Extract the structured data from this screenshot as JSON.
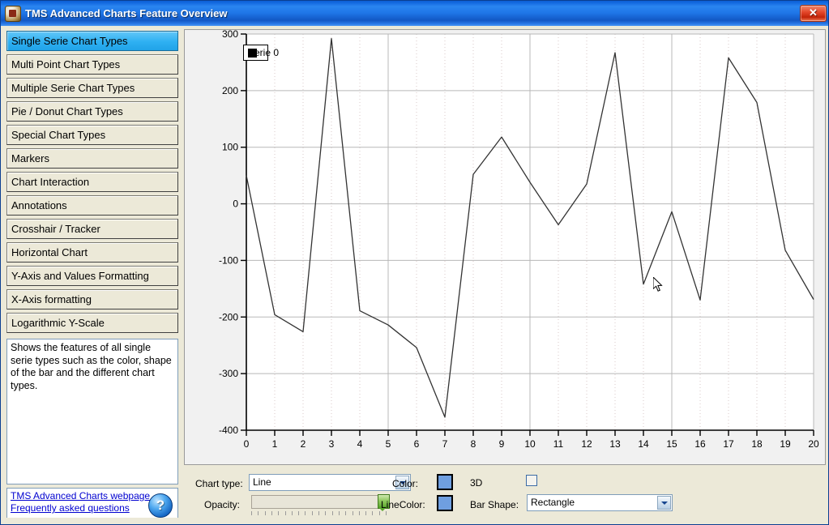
{
  "window": {
    "title": "TMS Advanced Charts Feature Overview",
    "app_icon": "app-icon",
    "close_label": "✕"
  },
  "sidebar": {
    "items": [
      {
        "label": "Single Serie Chart Types",
        "selected": true
      },
      {
        "label": "Multi Point Chart Types",
        "selected": false
      },
      {
        "label": "Multiple Serie Chart Types",
        "selected": false
      },
      {
        "label": "Pie / Donut Chart Types",
        "selected": false
      },
      {
        "label": "Special Chart Types",
        "selected": false
      },
      {
        "label": "Markers",
        "selected": false
      },
      {
        "label": "Chart Interaction",
        "selected": false
      },
      {
        "label": "Annotations",
        "selected": false
      },
      {
        "label": "Crosshair / Tracker",
        "selected": false
      },
      {
        "label": "Horizontal Chart",
        "selected": false
      },
      {
        "label": "Y-Axis and Values Formatting",
        "selected": false
      },
      {
        "label": "X-Axis formatting",
        "selected": false
      },
      {
        "label": "Logarithmic Y-Scale",
        "selected": false
      }
    ],
    "description": "Shows the features of all single serie types such as the color, shape of the bar and the different chart types.",
    "links": [
      {
        "label": "TMS Advanced Charts webpage"
      },
      {
        "label": "Frequently asked questions"
      }
    ],
    "help_glyph": "?"
  },
  "controls": {
    "chart_type_label": "Chart type:",
    "chart_type_value": "Line",
    "opacity_label": "Opacity:",
    "opacity_value": 100,
    "color_label": "Color:",
    "color_value": "#6f9fe0",
    "linecolor_label": "LineColor:",
    "linecolor_value": "#6f9fe0",
    "threed_label": "3D",
    "threed_checked": false,
    "bar_shape_label": "Bar Shape:",
    "bar_shape_value": "Rectangle"
  },
  "chart_data": {
    "type": "line",
    "title": "",
    "subtitle": "",
    "xlabel": "",
    "ylabel": "",
    "legend": [
      "Serie 0"
    ],
    "legend_position": "top-left",
    "legend_swatch_color": "#000000",
    "line_color": "#333333",
    "grid": true,
    "background": "#ffffff",
    "plot_area_background": "#f1f1f1",
    "xlim": [
      0,
      20
    ],
    "ylim": [
      -400,
      300
    ],
    "xticks": [
      0,
      1,
      2,
      3,
      4,
      5,
      6,
      7,
      8,
      9,
      10,
      11,
      12,
      13,
      14,
      15,
      16,
      17,
      18,
      19,
      20
    ],
    "yticks": [
      -400,
      -300,
      -200,
      -100,
      0,
      100,
      200,
      300
    ],
    "x": [
      0,
      1,
      2,
      3,
      4,
      5,
      6,
      7,
      8,
      9,
      10,
      11,
      12,
      13,
      14,
      15,
      16,
      17,
      18,
      19,
      20
    ],
    "series": [
      {
        "name": "Serie 0",
        "values": [
          50,
          -196,
          -226,
          292,
          -189,
          -214,
          -254,
          -377,
          52,
          118,
          38,
          -37,
          35,
          267,
          -142,
          -14,
          -170,
          258,
          179,
          -82,
          -169
        ]
      }
    ]
  }
}
